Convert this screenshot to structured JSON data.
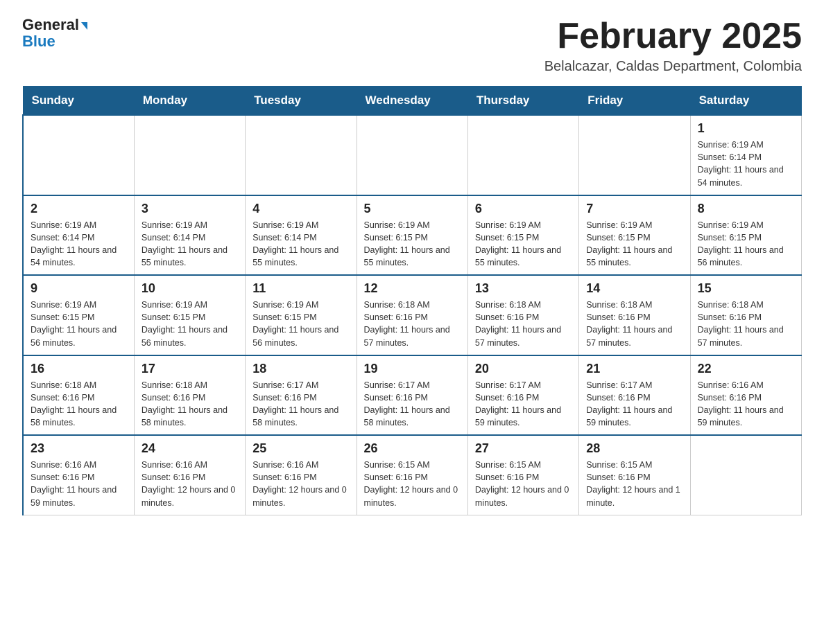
{
  "logo": {
    "general": "General",
    "blue": "Blue",
    "arrow": "▼"
  },
  "title": "February 2025",
  "subtitle": "Belalcazar, Caldas Department, Colombia",
  "days_of_week": [
    "Sunday",
    "Monday",
    "Tuesday",
    "Wednesday",
    "Thursday",
    "Friday",
    "Saturday"
  ],
  "weeks": [
    [
      {
        "day": "",
        "info": ""
      },
      {
        "day": "",
        "info": ""
      },
      {
        "day": "",
        "info": ""
      },
      {
        "day": "",
        "info": ""
      },
      {
        "day": "",
        "info": ""
      },
      {
        "day": "",
        "info": ""
      },
      {
        "day": "1",
        "info": "Sunrise: 6:19 AM\nSunset: 6:14 PM\nDaylight: 11 hours\nand 54 minutes."
      }
    ],
    [
      {
        "day": "2",
        "info": "Sunrise: 6:19 AM\nSunset: 6:14 PM\nDaylight: 11 hours\nand 54 minutes."
      },
      {
        "day": "3",
        "info": "Sunrise: 6:19 AM\nSunset: 6:14 PM\nDaylight: 11 hours\nand 55 minutes."
      },
      {
        "day": "4",
        "info": "Sunrise: 6:19 AM\nSunset: 6:14 PM\nDaylight: 11 hours\nand 55 minutes."
      },
      {
        "day": "5",
        "info": "Sunrise: 6:19 AM\nSunset: 6:15 PM\nDaylight: 11 hours\nand 55 minutes."
      },
      {
        "day": "6",
        "info": "Sunrise: 6:19 AM\nSunset: 6:15 PM\nDaylight: 11 hours\nand 55 minutes."
      },
      {
        "day": "7",
        "info": "Sunrise: 6:19 AM\nSunset: 6:15 PM\nDaylight: 11 hours\nand 55 minutes."
      },
      {
        "day": "8",
        "info": "Sunrise: 6:19 AM\nSunset: 6:15 PM\nDaylight: 11 hours\nand 56 minutes."
      }
    ],
    [
      {
        "day": "9",
        "info": "Sunrise: 6:19 AM\nSunset: 6:15 PM\nDaylight: 11 hours\nand 56 minutes."
      },
      {
        "day": "10",
        "info": "Sunrise: 6:19 AM\nSunset: 6:15 PM\nDaylight: 11 hours\nand 56 minutes."
      },
      {
        "day": "11",
        "info": "Sunrise: 6:19 AM\nSunset: 6:15 PM\nDaylight: 11 hours\nand 56 minutes."
      },
      {
        "day": "12",
        "info": "Sunrise: 6:18 AM\nSunset: 6:16 PM\nDaylight: 11 hours\nand 57 minutes."
      },
      {
        "day": "13",
        "info": "Sunrise: 6:18 AM\nSunset: 6:16 PM\nDaylight: 11 hours\nand 57 minutes."
      },
      {
        "day": "14",
        "info": "Sunrise: 6:18 AM\nSunset: 6:16 PM\nDaylight: 11 hours\nand 57 minutes."
      },
      {
        "day": "15",
        "info": "Sunrise: 6:18 AM\nSunset: 6:16 PM\nDaylight: 11 hours\nand 57 minutes."
      }
    ],
    [
      {
        "day": "16",
        "info": "Sunrise: 6:18 AM\nSunset: 6:16 PM\nDaylight: 11 hours\nand 58 minutes."
      },
      {
        "day": "17",
        "info": "Sunrise: 6:18 AM\nSunset: 6:16 PM\nDaylight: 11 hours\nand 58 minutes."
      },
      {
        "day": "18",
        "info": "Sunrise: 6:17 AM\nSunset: 6:16 PM\nDaylight: 11 hours\nand 58 minutes."
      },
      {
        "day": "19",
        "info": "Sunrise: 6:17 AM\nSunset: 6:16 PM\nDaylight: 11 hours\nand 58 minutes."
      },
      {
        "day": "20",
        "info": "Sunrise: 6:17 AM\nSunset: 6:16 PM\nDaylight: 11 hours\nand 59 minutes."
      },
      {
        "day": "21",
        "info": "Sunrise: 6:17 AM\nSunset: 6:16 PM\nDaylight: 11 hours\nand 59 minutes."
      },
      {
        "day": "22",
        "info": "Sunrise: 6:16 AM\nSunset: 6:16 PM\nDaylight: 11 hours\nand 59 minutes."
      }
    ],
    [
      {
        "day": "23",
        "info": "Sunrise: 6:16 AM\nSunset: 6:16 PM\nDaylight: 11 hours\nand 59 minutes."
      },
      {
        "day": "24",
        "info": "Sunrise: 6:16 AM\nSunset: 6:16 PM\nDaylight: 12 hours\nand 0 minutes."
      },
      {
        "day": "25",
        "info": "Sunrise: 6:16 AM\nSunset: 6:16 PM\nDaylight: 12 hours\nand 0 minutes."
      },
      {
        "day": "26",
        "info": "Sunrise: 6:15 AM\nSunset: 6:16 PM\nDaylight: 12 hours\nand 0 minutes."
      },
      {
        "day": "27",
        "info": "Sunrise: 6:15 AM\nSunset: 6:16 PM\nDaylight: 12 hours\nand 0 minutes."
      },
      {
        "day": "28",
        "info": "Sunrise: 6:15 AM\nSunset: 6:16 PM\nDaylight: 12 hours\nand 1 minute."
      },
      {
        "day": "",
        "info": ""
      }
    ]
  ]
}
